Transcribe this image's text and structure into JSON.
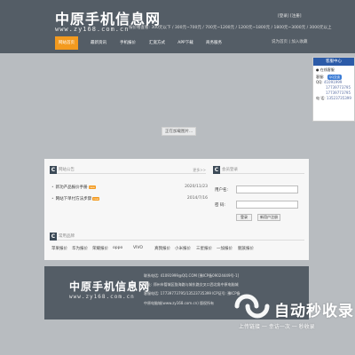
{
  "header": {
    "title": "中原手机信息网",
    "url": "www.zy168.com.cn",
    "top_links": "[登录]  [注册]",
    "price_tags": "按价格查看: 300元以下 / 300元~700元 / 700元~1200元 / 1200元~1800元 / 1800元~3000元 / 3000元以上"
  },
  "nav": {
    "items": [
      "网站首页",
      "最新资讯",
      "手机报价",
      "汇宽方式",
      "APP下载",
      "商务服务"
    ],
    "active_index": 0,
    "right": "说为首页  |  加入收藏"
  },
  "loading": "正在加载图片...",
  "side_panel": {
    "header": "客服中心",
    "sub": "● 在线客服",
    "lines": [
      {
        "label": "客服:",
        "value": ""
      },
      {
        "label": "QQ:",
        "value": "41091999"
      },
      {
        "label": "",
        "value": "17739773795"
      },
      {
        "label": "",
        "value": "17739773795"
      },
      {
        "label": "电 话:",
        "value": "13523735399"
      }
    ],
    "qq_button": "QQ交谈"
  },
  "news": {
    "title": "网站公告",
    "more": "更多>>",
    "items": [
      {
        "text": "新功产品报价手册",
        "hot": "new",
        "date": "2020/11/23"
      },
      {
        "text": "网站下单付方法步骤",
        "hot": "new",
        "date": "2014/7/16"
      }
    ]
  },
  "login": {
    "title": "会员登录",
    "user_label": "用户名:",
    "pass_label": "密    码:",
    "login_button": "登录",
    "register_button": "新用户注册"
  },
  "brands": {
    "title": "常用品牌",
    "items": [
      "苹果报价",
      "华为报价",
      "荣耀报价",
      "oppo",
      "VIVO",
      "真我报价",
      "小米报价",
      "三星报价",
      "一加报价",
      "魅族报价"
    ]
  },
  "footer": {
    "title": "中原手机信息网",
    "url": "www.zy168.com.cn",
    "lines": [
      "联系电话: 41091999@QQ.COM  [豫ICP备09024449号-1]",
      "地址: 郑州市管城区陇海路与城东路交叉口西北角中原电脑城",
      "客服电话: 17739773795/13523735399  ICP证号: 豫ICP备",
      "中原电脑城(www.zy168.com.cn) 版权所有"
    ]
  },
  "watermark": {
    "text": "自动秒收录",
    "sub": "上传链接 一 幸访一次 一 秒收录"
  },
  "colors": {
    "header_bg": "#545d66",
    "nav_active": "#f39a1f",
    "side_head": "#2c5ba8",
    "page_bg": "#b8bcc0"
  }
}
